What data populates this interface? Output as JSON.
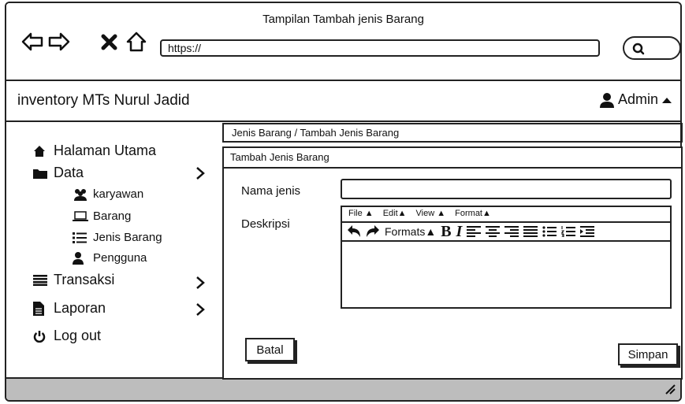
{
  "browser": {
    "title": "Tampilan Tambah jenis Barang",
    "url": "https://",
    "icons": [
      "back-arrow-icon",
      "forward-arrow-icon",
      "close-icon",
      "home-icon"
    ]
  },
  "app": {
    "brand": "inventory MTs Nurul Jadid",
    "user": "Admin"
  },
  "sidebar": {
    "items": [
      {
        "label": "Halaman Utama",
        "icon": "home-icon"
      },
      {
        "label": "Data",
        "icon": "folder-icon",
        "sub": [
          {
            "label": "karyawan",
            "icon": "users-icon"
          },
          {
            "label": "Barang",
            "icon": "laptop-icon"
          },
          {
            "label": "Jenis Barang",
            "icon": "list-icon"
          },
          {
            "label": "Pengguna",
            "icon": "user-icon"
          }
        ]
      },
      {
        "label": "Transaksi",
        "icon": "menu-icon"
      },
      {
        "label": "Laporan",
        "icon": "file-icon"
      },
      {
        "label": "Log out",
        "icon": "power-icon"
      }
    ]
  },
  "breadcrumb": "Jenis Barang / Tambah Jenis Barang",
  "form": {
    "title": "Tambah Jenis Barang",
    "name_label": "Nama jenis",
    "desc_label": "Deskripsi",
    "editor_menu": [
      "File",
      "Edit",
      "View",
      "Format"
    ],
    "formats_label": "Formats",
    "cancel": "Batal",
    "save": "Simpan"
  }
}
